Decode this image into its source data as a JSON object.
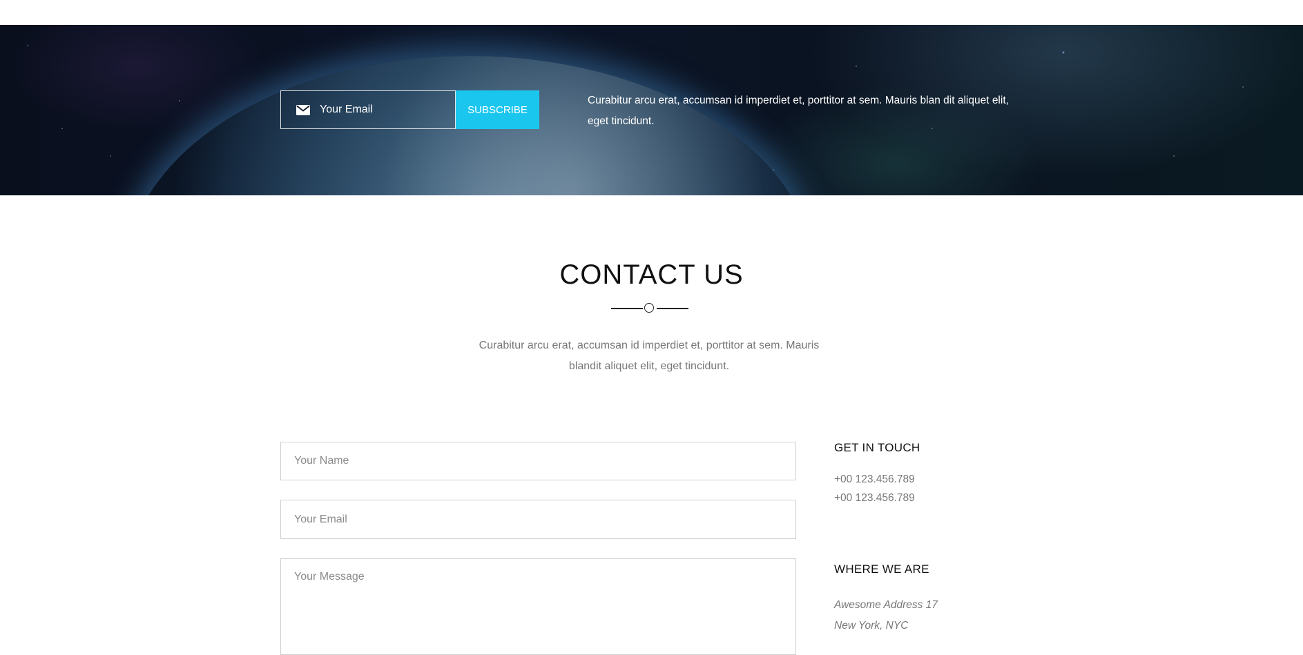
{
  "newsletter": {
    "email_placeholder": "Your Email",
    "subscribe_label": "SUBSCRIBE",
    "text": "Curabitur arcu erat, accumsan id imperdiet et, porttitor at sem. Mauris blan dit aliquet elit, eget tincidunt.",
    "icon": "envelope-icon",
    "accent_color": "#1bc6ee"
  },
  "contact": {
    "title": "CONTACT US",
    "intro": "Curabitur arcu erat, accumsan id imperdiet et, porttitor at sem. Mauris blandit aliquet elit, eget tincidunt.",
    "form": {
      "name_placeholder": "Your Name",
      "email_placeholder": "Your Email",
      "message_placeholder": "Your Message"
    },
    "get_in_touch": {
      "heading": "GET IN TOUCH",
      "phones": [
        "+00 123.456.789",
        "+00 123.456.789"
      ]
    },
    "where_we_are": {
      "heading": "WHERE WE ARE",
      "address_lines": [
        "Awesome Address 17",
        "New York, NYC"
      ]
    }
  }
}
